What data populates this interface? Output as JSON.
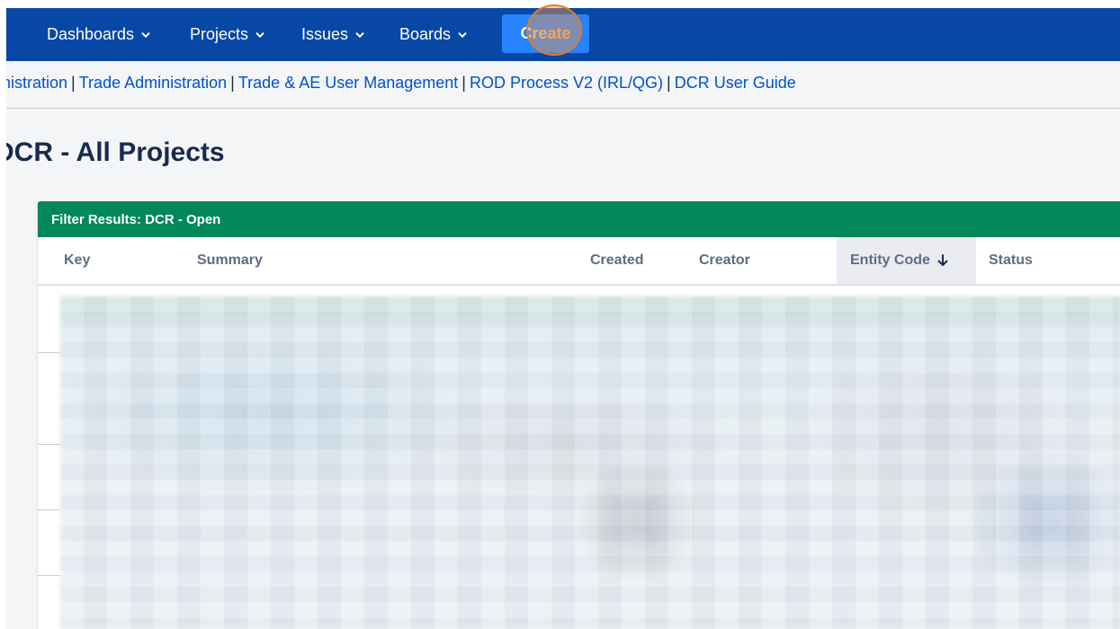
{
  "navbar": {
    "items": [
      {
        "label": "Dashboards"
      },
      {
        "label": "Projects"
      },
      {
        "label": "Issues"
      },
      {
        "label": "Boards"
      }
    ],
    "create_label": "Create"
  },
  "links": [
    "inistration",
    "Trade Administration",
    "Trade & AE User Management",
    "ROD Process V2 (IRL/QG)",
    "DCR User Guide"
  ],
  "page_title": "DCR - All Projects",
  "gadget": {
    "title": "Filter Results: DCR - Open",
    "columns": [
      "Key",
      "Summary",
      "Created",
      "Creator",
      "Entity Code",
      "Status"
    ],
    "sorted_column": "Entity Code",
    "sort_direction": "descending"
  },
  "colors": {
    "navbar": "#0747a6",
    "create_button": "#2684ff",
    "gadget_header": "#00875a",
    "link": "#0052cc",
    "title": "#172b4d"
  }
}
